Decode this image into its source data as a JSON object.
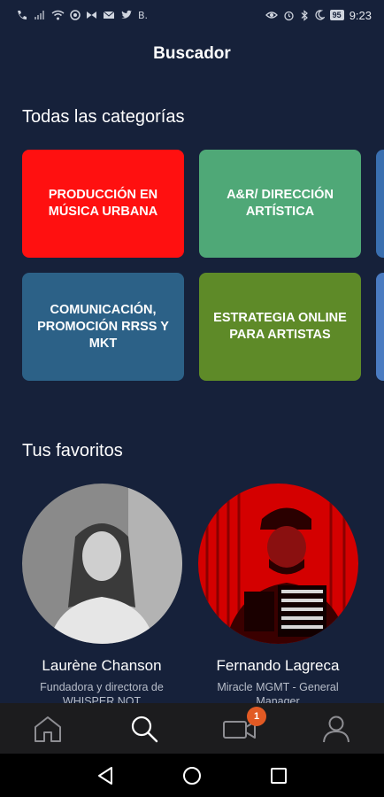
{
  "status_bar": {
    "time": "9:23",
    "battery": "95",
    "left_icons": [
      "phone-wifi-icon",
      "signal-icon",
      "wifi-icon",
      "app-icon",
      "bowtie-icon",
      "mail-icon",
      "twitter-icon",
      "booking-icon"
    ],
    "left_glyph": "B.",
    "right_icons": [
      "eye-icon",
      "alarm-icon",
      "bluetooth-icon",
      "moon-icon"
    ]
  },
  "header": {
    "title": "Buscador"
  },
  "categories": {
    "title": "Todas las categorías",
    "items": [
      {
        "label": "PRODUCCIÓN EN MÚSICA URBANA",
        "color": "#ff1010"
      },
      {
        "label": "A&R/ DIRECCIÓN ARTÍSTICA",
        "color": "#4fa877"
      },
      {
        "label": "",
        "color": "#3a6fb0"
      },
      {
        "label": "COMUNICACIÓN, PROMOCIÓN RRSS Y MKT",
        "color": "#2c6187"
      },
      {
        "label": "ESTRATEGIA ONLINE PARA ARTISTAS",
        "color": "#5e8a28"
      },
      {
        "label": "",
        "color": "#4a7bc1"
      }
    ]
  },
  "favorites": {
    "title": "Tus favoritos",
    "items": [
      {
        "name": "Laurène Chanson",
        "role": "Fundadora y directora de WHISPER NOT"
      },
      {
        "name": "Fernando Lagreca",
        "role": "Miracle MGMT - General Manager"
      }
    ]
  },
  "tab_bar": {
    "items": [
      "home-icon",
      "search-icon",
      "video-icon",
      "profile-icon"
    ],
    "badge": "1",
    "active_color": "#ffffff",
    "inactive_color": "#8e8e93"
  },
  "system_nav": [
    "back-icon",
    "home-circle-icon",
    "recents-icon"
  ]
}
